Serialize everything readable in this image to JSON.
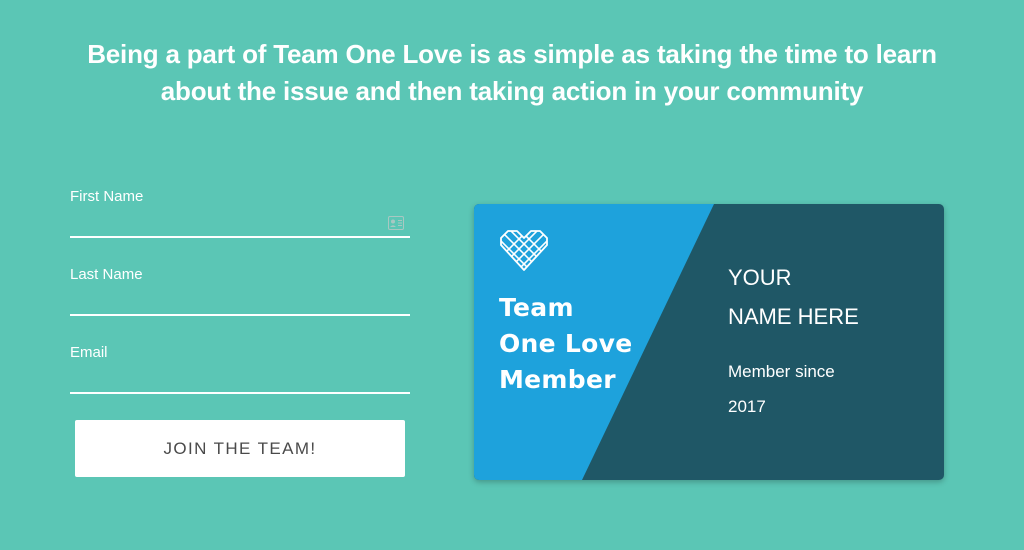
{
  "headline": {
    "line1": "Being a part of Team One Love is as simple as taking the time to learn",
    "line2": "about the issue and then taking action in your community"
  },
  "form": {
    "first_name_label": "First Name",
    "first_name_value": "",
    "last_name_label": "Last Name",
    "last_name_value": "",
    "email_label": "Email",
    "email_value": "",
    "autofill_icon": "contact-card-icon",
    "join_button_label": "JOIN THE TEAM!"
  },
  "card": {
    "icon": "heart-icon",
    "title_line1": "Team",
    "title_line2": "One Love",
    "title_line3": "Member",
    "name_line1": "YOUR",
    "name_line2": "NAME HERE",
    "member_since_label": "Member since",
    "member_since_year": "2017"
  },
  "colors": {
    "background": "#5bc6b5",
    "card_left": "#1ea2dc",
    "card_right": "#1f5766",
    "button_text": "#4a4a4a"
  }
}
